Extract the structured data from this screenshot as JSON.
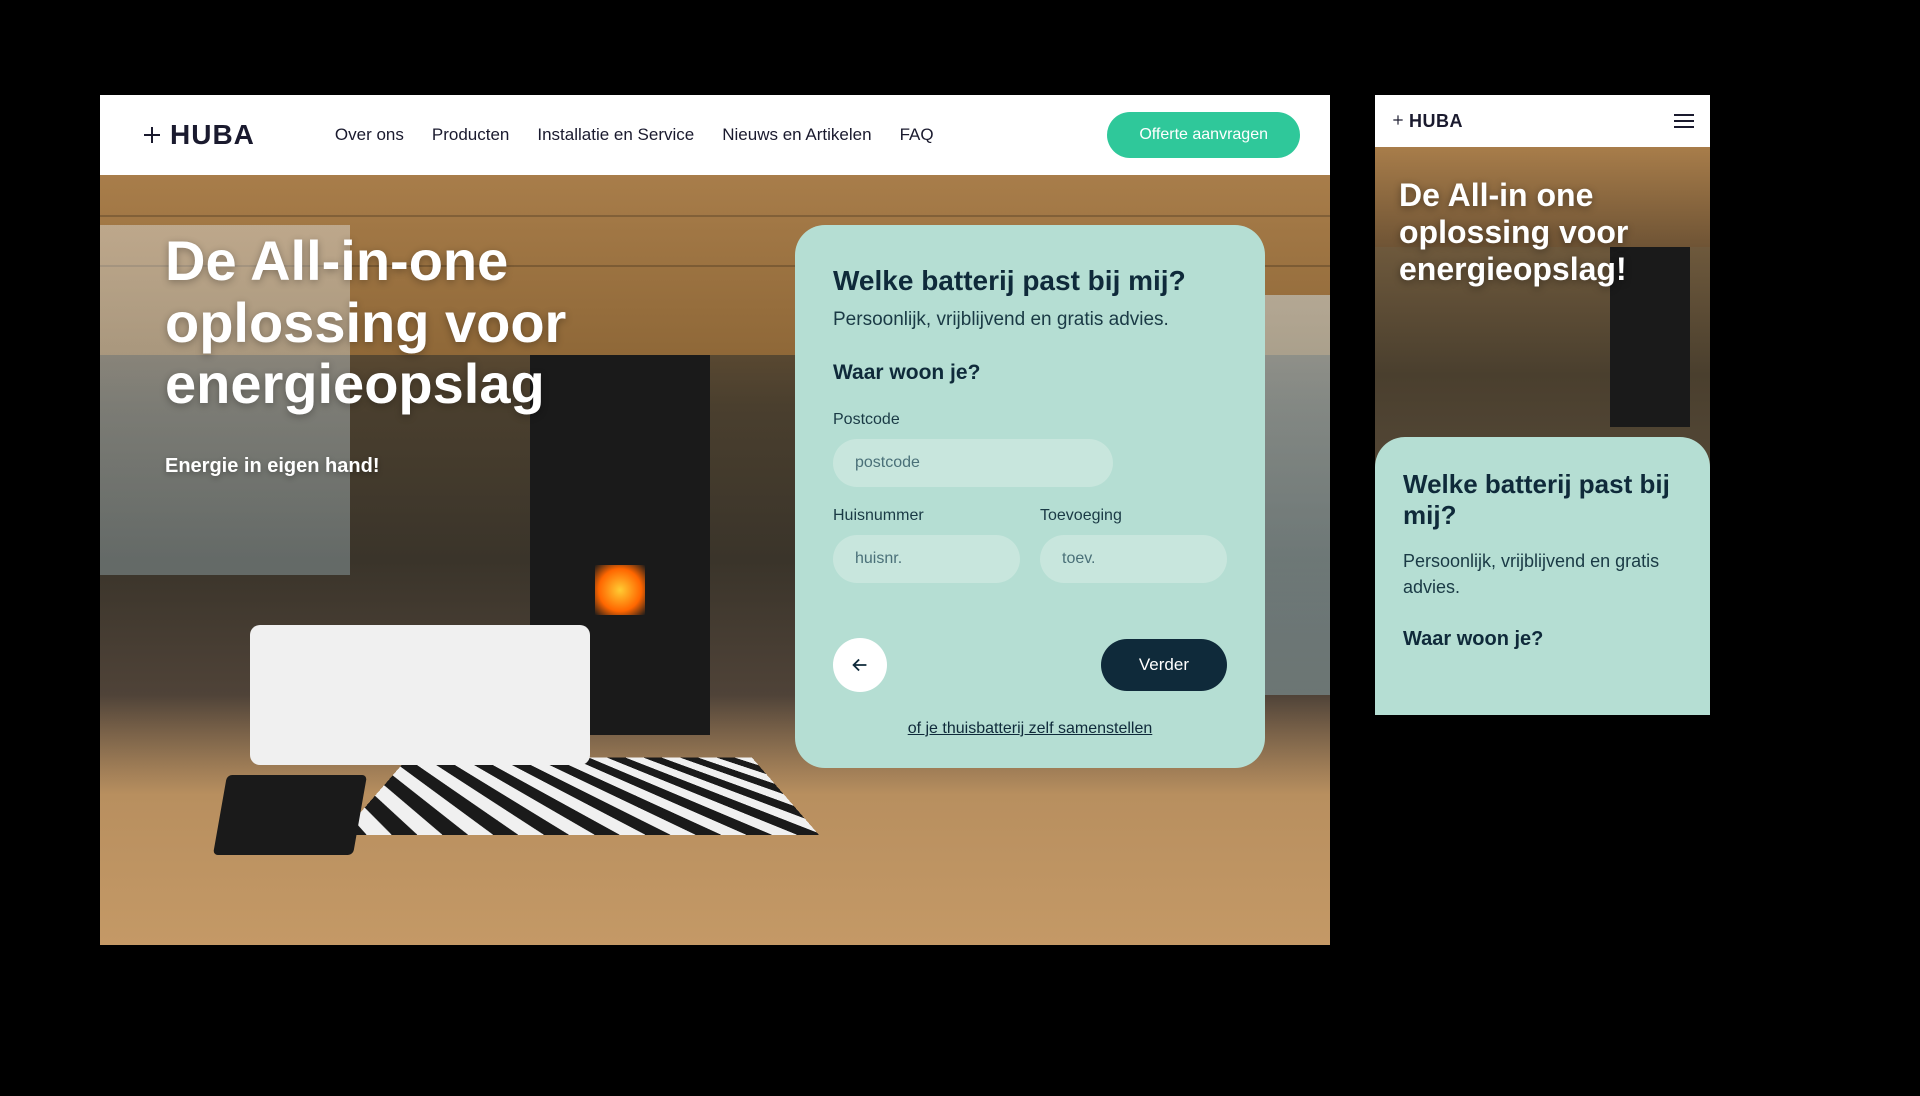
{
  "brand": {
    "name": "HUBA",
    "mark_prefix": "+"
  },
  "nav": {
    "items": [
      {
        "label": "Over ons"
      },
      {
        "label": "Producten"
      },
      {
        "label": "Installatie en Service"
      },
      {
        "label": "Nieuws en Artikelen"
      },
      {
        "label": "FAQ"
      }
    ],
    "cta": "Offerte aanvragen"
  },
  "hero": {
    "title_desktop": "De All-in-one oplossing voor energieopslag",
    "title_mobile": "De All-in one oplossing voor energieopslag!",
    "subtitle": "Energie in eigen hand!"
  },
  "form": {
    "title": "Welke batterij past bij mij?",
    "subtitle": "Persoonlijk, vrijblijvend en gratis advies.",
    "question": "Waar woon je?",
    "fields": {
      "postcode": {
        "label": "Postcode",
        "placeholder": "postcode"
      },
      "huisnummer": {
        "label": "Huisnummer",
        "placeholder": "huisnr."
      },
      "toevoeging": {
        "label": "Toevoeging",
        "placeholder": "toev."
      }
    },
    "next_label": "Verder",
    "link": "of je thuisbatterij zelf samenstellen"
  }
}
